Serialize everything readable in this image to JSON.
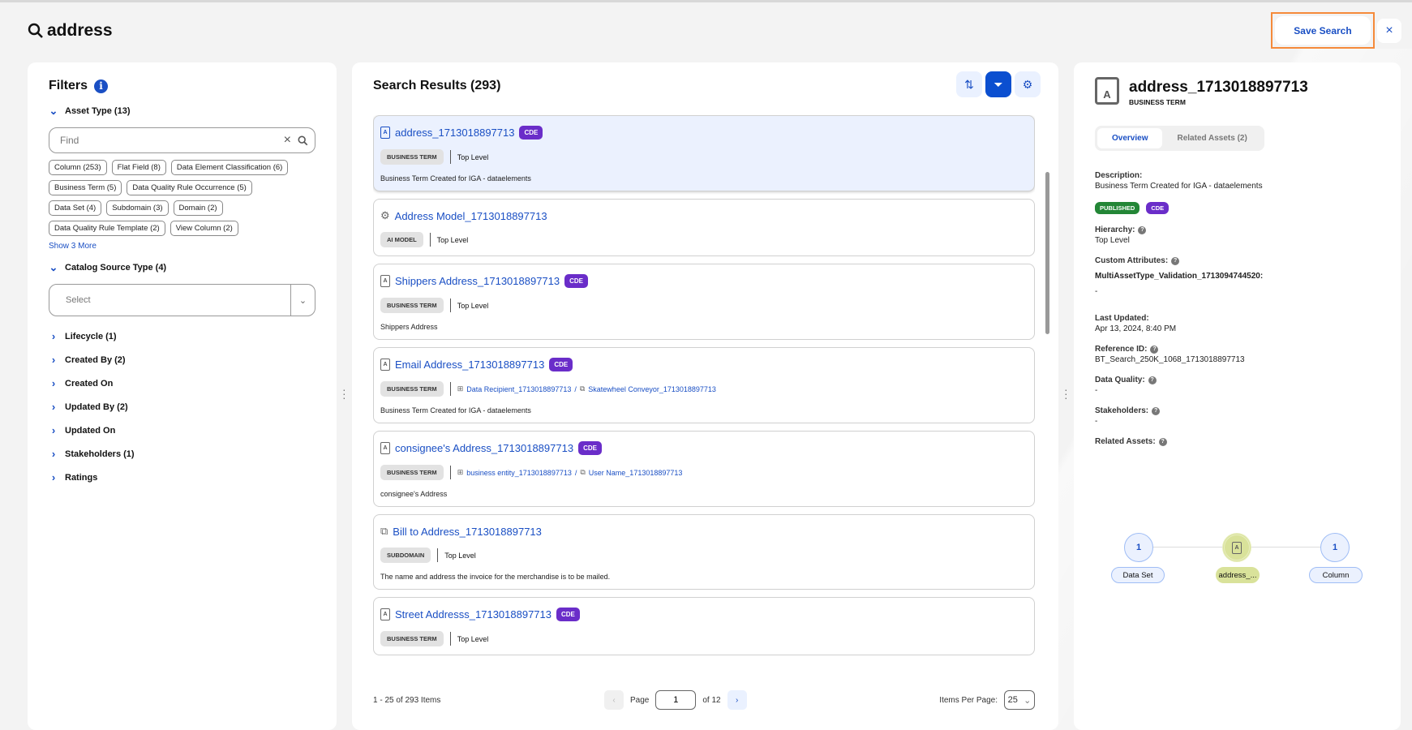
{
  "query": "address",
  "header": {
    "save_label": "Save Search",
    "close_icon": "×"
  },
  "filters": {
    "title": "Filters",
    "asset_type": {
      "label": "Asset Type (13)",
      "find_placeholder": "Find",
      "chips": [
        "Column (253)",
        "Flat Field (8)",
        "Data Element Classification (6)",
        "Business Term (5)",
        "Data Quality Rule Occurrence (5)",
        "Data Set (4)",
        "Subdomain (3)",
        "Domain (2)",
        "Data Quality Rule Template (2)",
        "View Column (2)"
      ],
      "show_more": "Show 3 More"
    },
    "catalog_source": {
      "label": "Catalog Source Type (4)",
      "placeholder": "Select"
    },
    "collapsed": [
      "Lifecycle (1)",
      "Created By (2)",
      "Created On",
      "Updated By (2)",
      "Updated On",
      "Stakeholders (1)",
      "Ratings"
    ]
  },
  "results": {
    "title": "Search Results (293)",
    "items": [
      {
        "name": "address_1713018897713",
        "cde": "CDE",
        "type": "BUSINESS TERM",
        "path": "Top Level",
        "desc": "Business Term Created for IGA - dataelements",
        "icon": "business-term"
      },
      {
        "name": "Address Model_1713018897713",
        "cde": "",
        "type": "AI MODEL",
        "path": "Top Level",
        "desc": "",
        "icon": "ai-model"
      },
      {
        "name": "Shippers Address_1713018897713",
        "cde": "CDE",
        "type": "BUSINESS TERM",
        "path": "Top Level",
        "desc": "Shippers Address",
        "icon": "business-term"
      },
      {
        "name": "Email Address_1713018897713",
        "cde": "CDE",
        "type": "BUSINESS TERM",
        "path1": "Data Recipient_1713018897713",
        "path2": "Skatewheel Conveyor_1713018897713",
        "desc": "Business Term Created for IGA - dataelements",
        "icon": "business-term"
      },
      {
        "name": "consignee's Address_1713018897713",
        "cde": "CDE",
        "type": "BUSINESS TERM",
        "path1": "business entity_1713018897713",
        "path2": "User Name_1713018897713",
        "desc": "consignee's Address",
        "icon": "business-term"
      },
      {
        "name": "Bill to Address_1713018897713",
        "cde": "",
        "type": "SUBDOMAIN",
        "path": "Top Level",
        "desc": "The name and address the invoice for the merchandise is to be mailed.",
        "icon": "subdomain"
      },
      {
        "name": "Street Addresss_1713018897713",
        "cde": "CDE",
        "type": "BUSINESS TERM",
        "path": "Top Level",
        "desc": "",
        "icon": "business-term"
      }
    ],
    "pager": {
      "summary": "1 - 25 of 293 Items",
      "page_label": "Page",
      "page": "1",
      "of": "of 12",
      "ipp_label": "Items Per Page:",
      "ipp": "25"
    }
  },
  "details": {
    "name": "address_1713018897713",
    "type": "BUSINESS TERM",
    "tabs": [
      "Overview",
      "Related Assets (2)"
    ],
    "description_label": "Description:",
    "description": "Business Term Created for IGA - dataelements",
    "badges": {
      "published": "PUBLISHED",
      "cde": "CDE"
    },
    "hierarchy_label": "Hierarchy:",
    "hierarchy": "Top Level",
    "custom_label": "Custom Attributes:",
    "custom_key": "MultiAssetType_Validation_1713094744520:",
    "custom_val": "-",
    "updated_label": "Last Updated:",
    "updated": "Apr 13, 2024, 8:40 PM",
    "ref_label": "Reference ID:",
    "ref": "BT_Search_250K_1068_1713018897713",
    "dq_label": "Data Quality:",
    "dq": "-",
    "stake_label": "Stakeholders:",
    "stake": "-",
    "related_label": "Related Assets:",
    "graph": {
      "left": {
        "count": "1",
        "label": "Data Set"
      },
      "center": {
        "label": "address_..."
      },
      "right": {
        "count": "1",
        "label": "Column"
      }
    }
  },
  "colors": {
    "accent": "#1a4fc4",
    "cde": "#6a2dc9",
    "published": "#238636",
    "highlight": "#f58a3a"
  }
}
